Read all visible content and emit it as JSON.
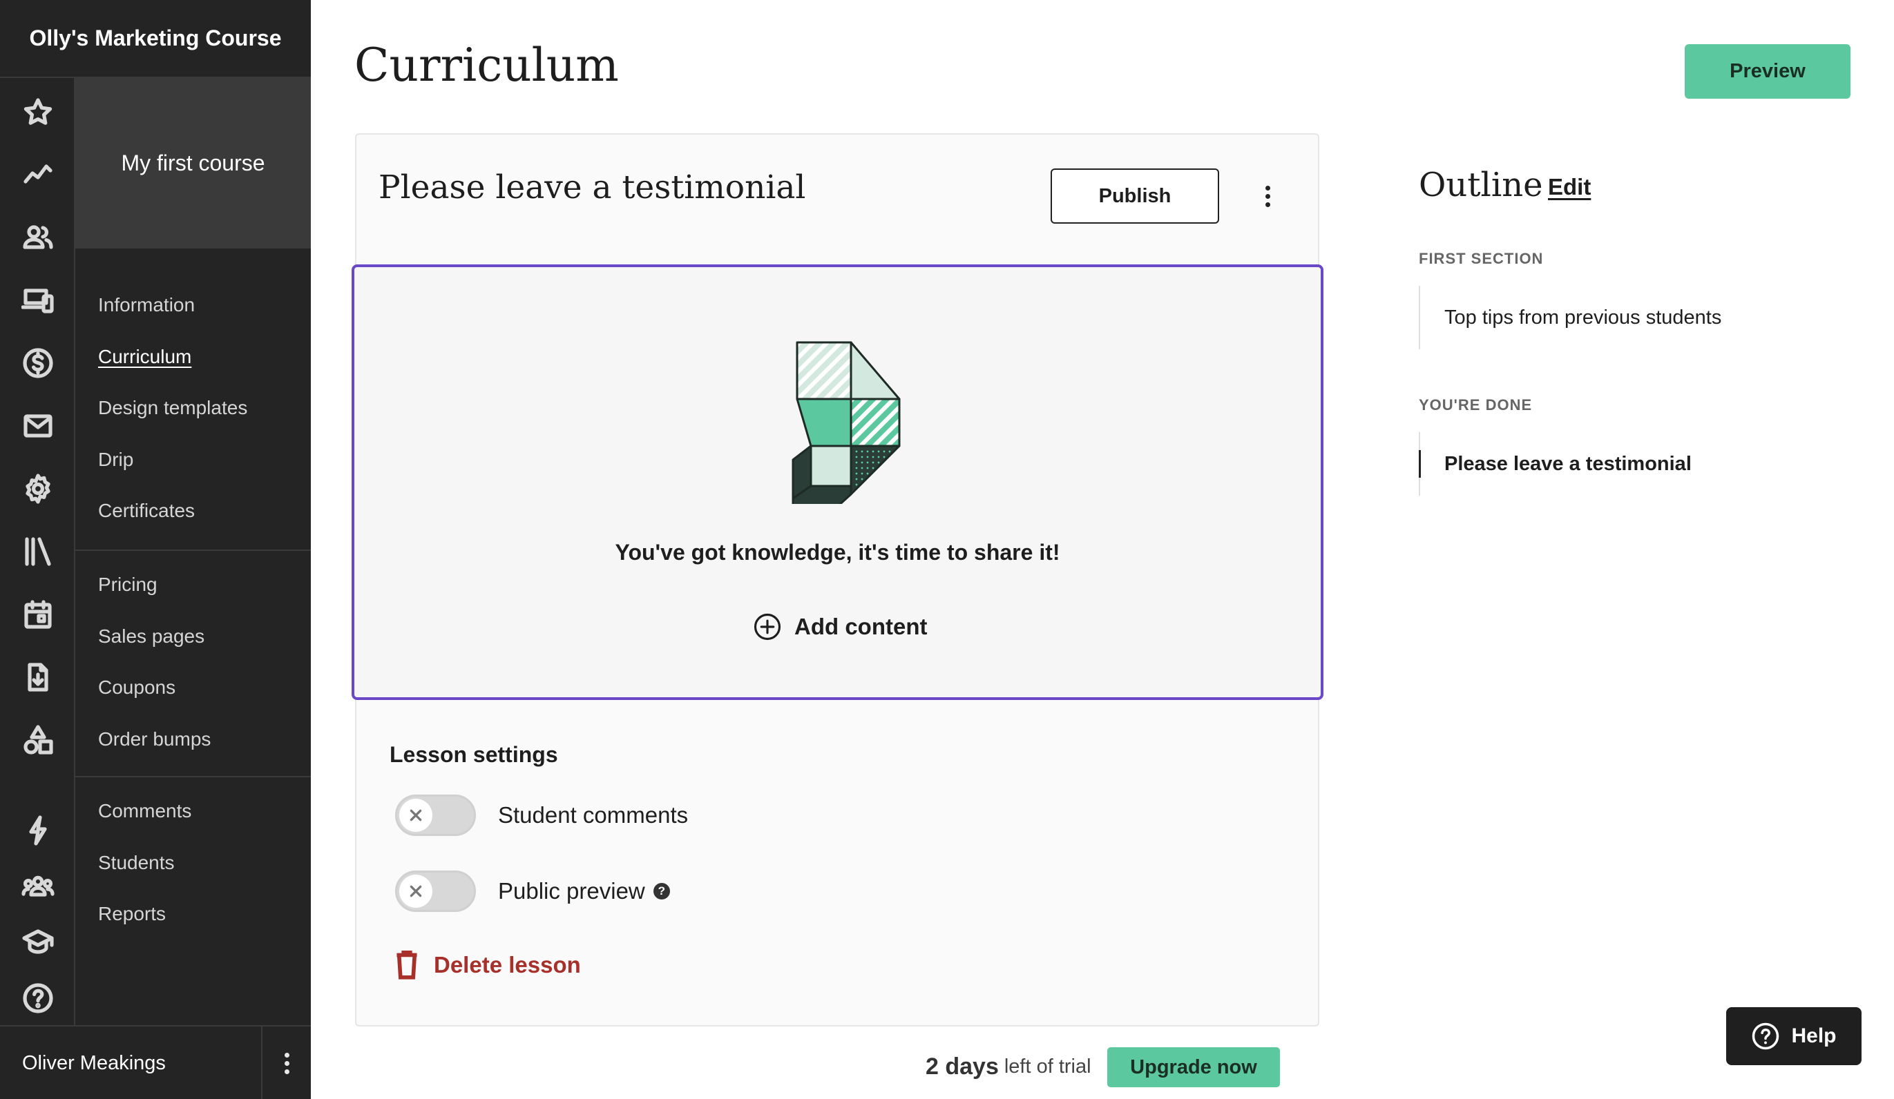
{
  "app": {
    "course_title": "Olly's Marketing Course"
  },
  "sidebar": {
    "course_card": "My first course",
    "nav_groups": [
      [
        {
          "label": "Information"
        },
        {
          "label": "Curriculum"
        },
        {
          "label": "Design templates"
        },
        {
          "label": "Drip"
        },
        {
          "label": "Certificates"
        }
      ],
      [
        {
          "label": "Pricing"
        },
        {
          "label": "Sales pages"
        },
        {
          "label": "Coupons"
        },
        {
          "label": "Order bumps"
        }
      ],
      [
        {
          "label": "Comments"
        },
        {
          "label": "Students"
        },
        {
          "label": "Reports"
        }
      ]
    ],
    "active_item": "Curriculum",
    "rail_icons": [
      "star-icon",
      "trend-icon",
      "users-icon",
      "devices-icon",
      "dollar-icon",
      "mail-icon",
      "gear-icon",
      "library-icon",
      "calendar-icon",
      "download-icon",
      "shapes-icon",
      "lightning-icon",
      "community-icon",
      "graduation-icon",
      "help-circle-icon"
    ],
    "user_name": "Oliver Meakings"
  },
  "main": {
    "page_title": "Curriculum",
    "preview_label": "Preview",
    "lesson": {
      "title": "Please leave a testimonial",
      "publish_label": "Publish",
      "empty_message": "You've got knowledge, it's time to share it!",
      "add_content_label": "Add content",
      "settings_heading": "Lesson settings",
      "toggles": [
        {
          "label": "Student comments",
          "on": false
        },
        {
          "label": "Public preview",
          "on": false,
          "help": "?"
        }
      ],
      "delete_label": "Delete lesson"
    }
  },
  "outline": {
    "title": "Outline",
    "edit_label": "Edit",
    "sections": [
      {
        "name": "FIRST SECTION",
        "lessons": [
          {
            "title": "Top tips from previous students",
            "current": false
          }
        ]
      },
      {
        "name": "YOU'RE DONE",
        "lessons": [
          {
            "title": "Please leave a testimonial",
            "current": true
          }
        ]
      }
    ]
  },
  "trial": {
    "days": "2 days",
    "suffix": "left of trial",
    "upgrade_label": "Upgrade now"
  },
  "help_label": "Help",
  "colors": {
    "accent": "#5cc8a0",
    "focus": "#6a48c8",
    "danger": "#a8302a",
    "sidebar_bg": "#242424"
  }
}
